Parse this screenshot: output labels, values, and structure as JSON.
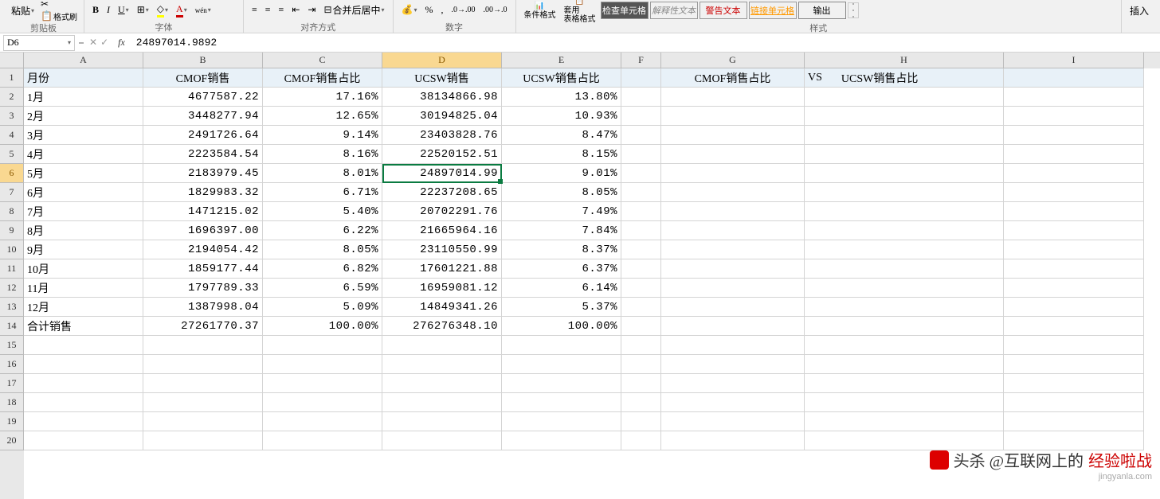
{
  "ribbon": {
    "clipboard": {
      "paste": "粘贴",
      "format_painter": "格式刷",
      "label": "剪贴板"
    },
    "font": {
      "label": "字体"
    },
    "alignment": {
      "merge": "合并后居中",
      "label": "对齐方式"
    },
    "number": {
      "label": "数字"
    },
    "styles": {
      "cond_format": "条件格式",
      "table_format": "套用\n表格格式",
      "check_cell": "检查单元格",
      "explain": "解释性文本",
      "warning": "警告文本",
      "link_cell": "链接单元格",
      "output": "输出",
      "label": "样式"
    },
    "insert": "插入"
  },
  "namebox": {
    "ref": "D6",
    "formula": "24897014.9892"
  },
  "columns": [
    "A",
    "B",
    "C",
    "D",
    "E",
    "F",
    "G",
    "H",
    "I"
  ],
  "headers": {
    "month": "月份",
    "cmof_sales": "CMOF销售",
    "cmof_pct": "CMOF销售占比",
    "ucsw_sales": "UCSW销售",
    "ucsw_pct": "UCSW销售占比",
    "cmp_left": "CMOF销售占比",
    "vs": "VS",
    "cmp_right": "UCSW销售占比"
  },
  "rows": [
    {
      "m": "1月",
      "a": "4677587.22",
      "b": "17.16%",
      "c": "38134866.98",
      "d": "13.80%"
    },
    {
      "m": "2月",
      "a": "3448277.94",
      "b": "12.65%",
      "c": "30194825.04",
      "d": "10.93%"
    },
    {
      "m": "3月",
      "a": "2491726.64",
      "b": "9.14%",
      "c": "23403828.76",
      "d": "8.47%"
    },
    {
      "m": "4月",
      "a": "2223584.54",
      "b": "8.16%",
      "c": "22520152.51",
      "d": "8.15%"
    },
    {
      "m": "5月",
      "a": "2183979.45",
      "b": "8.01%",
      "c": "24897014.99",
      "d": "9.01%"
    },
    {
      "m": "6月",
      "a": "1829983.32",
      "b": "6.71%",
      "c": "22237208.65",
      "d": "8.05%"
    },
    {
      "m": "7月",
      "a": "1471215.02",
      "b": "5.40%",
      "c": "20702291.76",
      "d": "7.49%"
    },
    {
      "m": "8月",
      "a": "1696397.00",
      "b": "6.22%",
      "c": "21665964.16",
      "d": "7.84%"
    },
    {
      "m": "9月",
      "a": "2194054.42",
      "b": "8.05%",
      "c": "23110550.99",
      "d": "8.37%"
    },
    {
      "m": "10月",
      "a": "1859177.44",
      "b": "6.82%",
      "c": "17601221.88",
      "d": "6.37%"
    },
    {
      "m": "11月",
      "a": "1797789.33",
      "b": "6.59%",
      "c": "16959081.12",
      "d": "6.14%"
    },
    {
      "m": "12月",
      "a": "1387998.04",
      "b": "5.09%",
      "c": "14849341.26",
      "d": "5.37%"
    },
    {
      "m": "合计销售",
      "a": "27261770.37",
      "b": "100.00%",
      "c": "276276348.10",
      "d": "100.00%"
    }
  ],
  "watermark": {
    "text": "头杀 @互联网上的",
    "suffix": "经验啦战",
    "url": "jingyanla.com"
  },
  "active": {
    "row": 6,
    "col": "D"
  }
}
